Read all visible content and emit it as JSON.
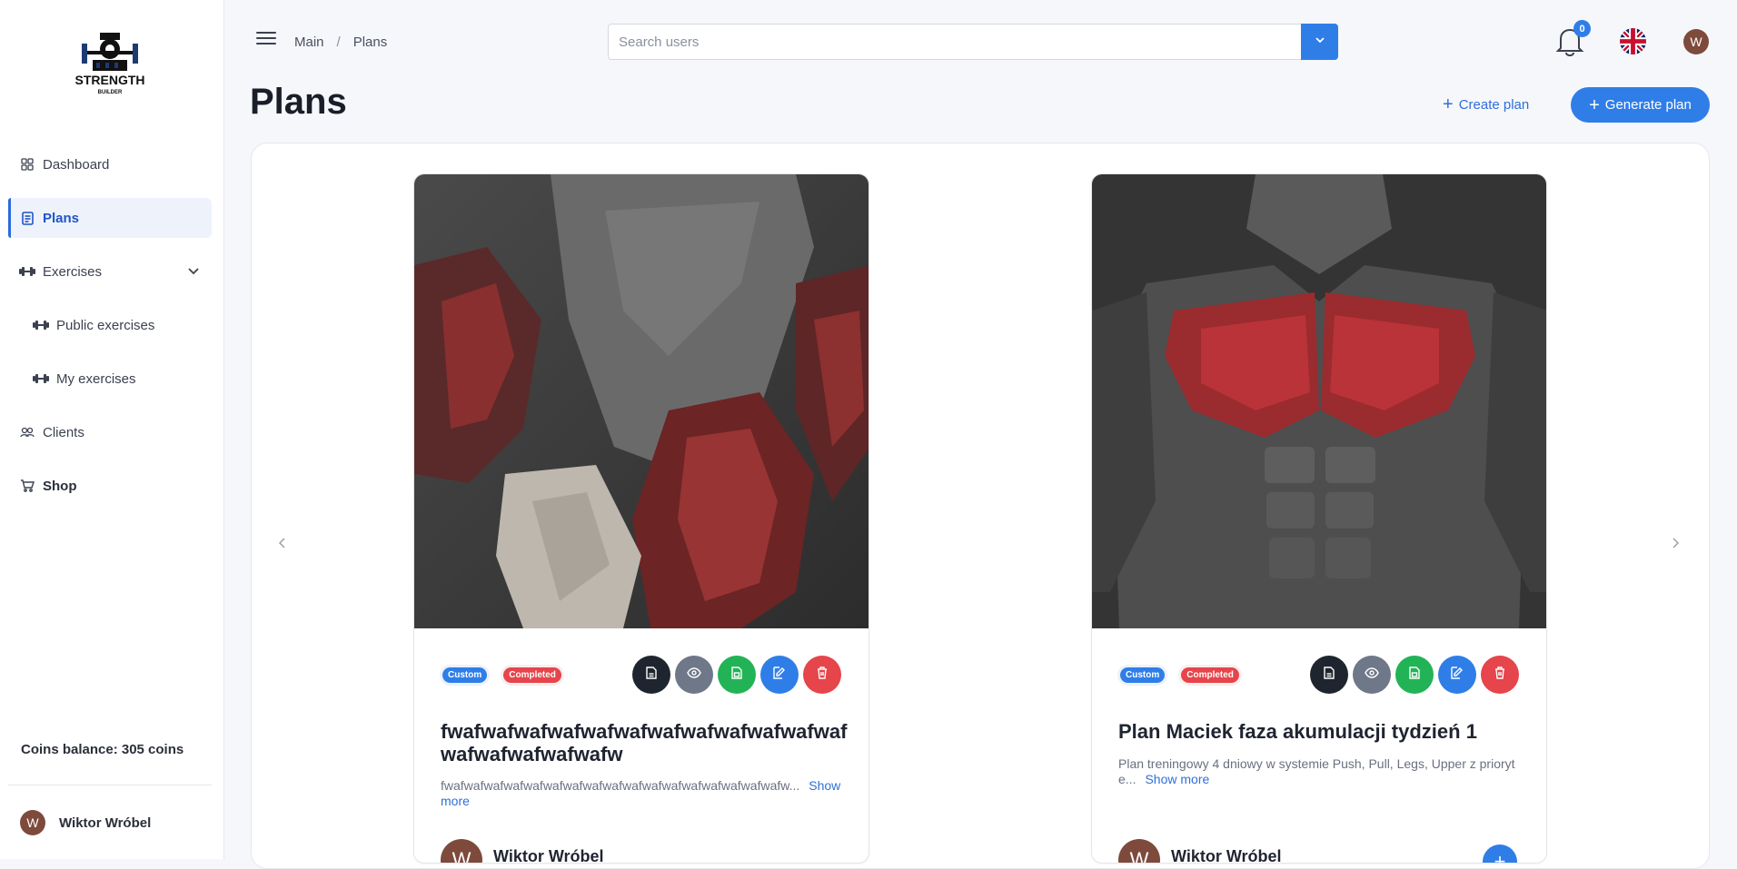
{
  "sidebar": {
    "logo_text": "STRENGTH BUILDER",
    "items": [
      {
        "label": "Dashboard",
        "icon": "grid-icon"
      },
      {
        "label": "Plans",
        "icon": "document-icon",
        "active": true
      },
      {
        "label": "Exercises",
        "icon": "dumbbell-icon",
        "expandable": true
      },
      {
        "label": "Public exercises",
        "icon": "dumbbell-icon"
      },
      {
        "label": "My exercises",
        "icon": "dumbbell-icon"
      },
      {
        "label": "Clients",
        "icon": "users-icon"
      },
      {
        "label": "Shop",
        "icon": "cart-icon"
      }
    ],
    "coins": "Coins balance: 305 coins",
    "user": {
      "initial": "W",
      "name": "Wiktor Wróbel"
    }
  },
  "topbar": {
    "breadcrumb": [
      "Main",
      "Plans"
    ],
    "search_placeholder": "Search users",
    "notifications_count": "0",
    "language": "English (UK flag)",
    "avatar_initial": "W"
  },
  "page": {
    "title": "Plans",
    "create_plan_label": "Create plan",
    "generate_plan_label": "Generate plan"
  },
  "cards": [
    {
      "image": "leg-muscles-illustration",
      "badges": [
        "Custom",
        "Completed"
      ],
      "title": "fwafwafwafwafwafwafwafwafwafwafwafwafwafwafwafwafwafw",
      "description": "fwafwafwafwafwafwafwafwafwafwafwafwafwafwafwafwafwafw...",
      "show_more": "Show more",
      "author_initial": "W",
      "author": "Wiktor Wróbel"
    },
    {
      "image": "chest-muscles-illustration",
      "badges": [
        "Custom",
        "Completed"
      ],
      "title": "Plan Maciek faza akumulacji tydzień 1",
      "description": "Plan treningowy 4 dniowy w systemie Push, Pull, Legs, Upper z prioryte...",
      "show_more": "Show more",
      "author_initial": "W",
      "author": "Wiktor Wróbel"
    }
  ],
  "colors": {
    "accent": "#2f7ee8",
    "danger": "#e5454b",
    "success": "#22b357",
    "dark": "#1f252e",
    "muted": "#6f7889"
  }
}
